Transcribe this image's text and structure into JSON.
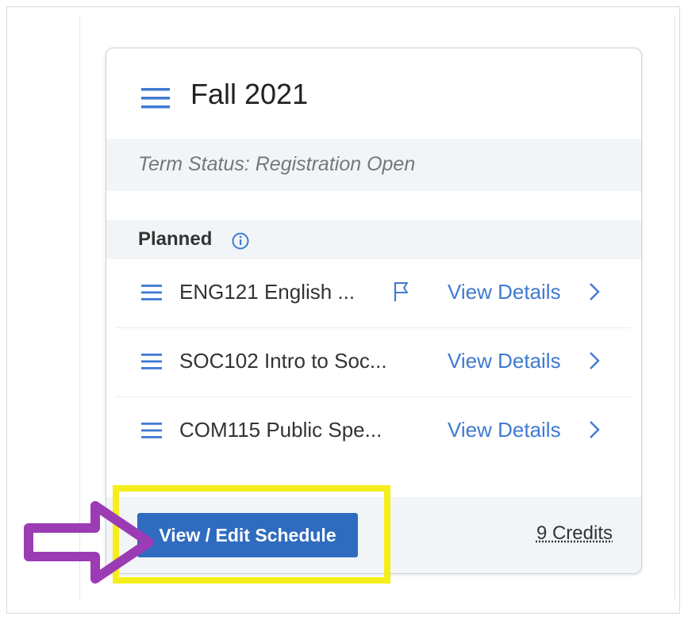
{
  "term": {
    "title": "Fall 2021",
    "status": "Term Status: Registration Open"
  },
  "planned": {
    "label": "Planned",
    "courses": [
      {
        "name": "ENG121 English ...",
        "flagged": true,
        "link": "View Details"
      },
      {
        "name": "SOC102 Intro to Soc...",
        "flagged": false,
        "link": "View Details"
      },
      {
        "name": "COM115 Public Spe...",
        "flagged": false,
        "link": "View Details"
      }
    ]
  },
  "footer": {
    "button_label": "View / Edit Schedule",
    "credits": "9 Credits"
  },
  "colors": {
    "accent": "#3f7ad1",
    "button": "#2f6cbf",
    "highlight": "#f5ee1a",
    "arrow": "#9b3cb4"
  },
  "icons": [
    "menu-icon",
    "info-icon",
    "flag-icon",
    "chevron-right-icon",
    "arrow-right-icon"
  ]
}
